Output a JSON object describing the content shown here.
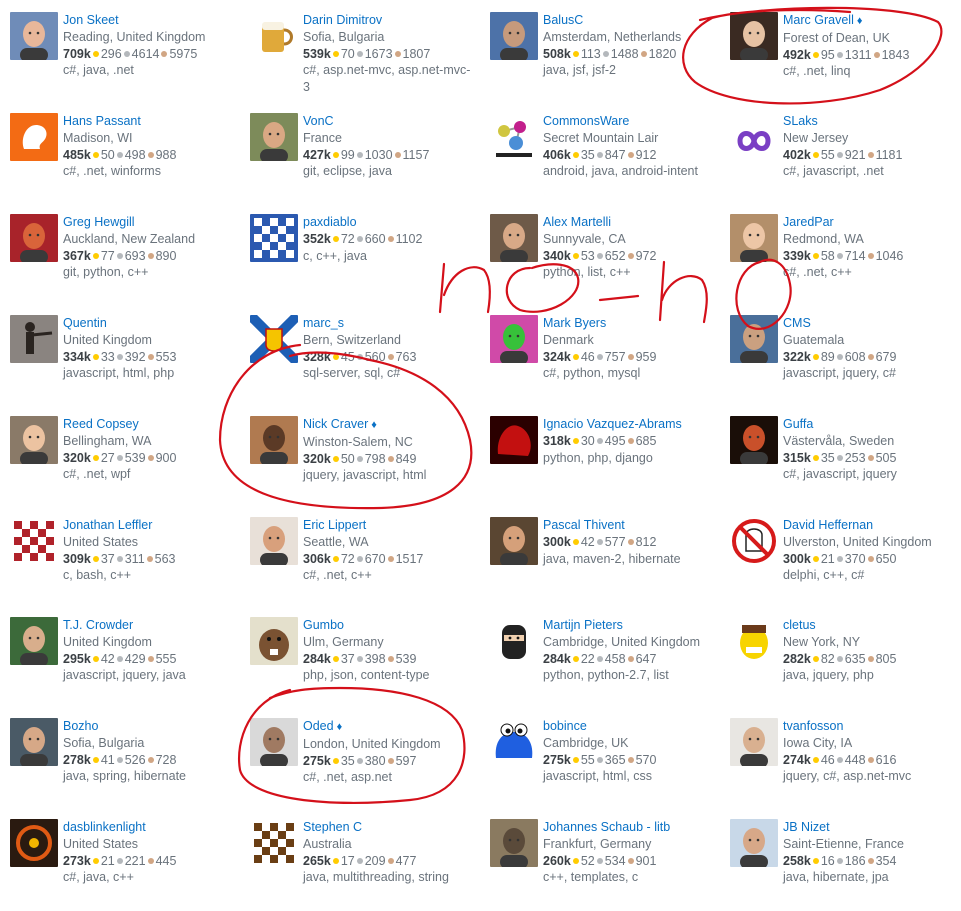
{
  "colors": {
    "link": "#0a71c5",
    "text": "#6a737c",
    "ink": "#d4101a",
    "gold": "#ffcc01",
    "silver": "#b4b8bc",
    "bronze": "#d1a684"
  },
  "users": [
    {
      "name": "Jon Skeet",
      "location": "Reading, United Kingdom",
      "rep": "709k",
      "gold": "296",
      "silver": "4614",
      "bronze": "5975",
      "tags": "c#, java, .net",
      "avatar": {
        "bg": "#6f8cb8",
        "fg": "#e8b79a",
        "type": "face"
      }
    },
    {
      "name": "Darin Dimitrov",
      "location": "Sofia, Bulgaria",
      "rep": "539k",
      "gold": "70",
      "silver": "1673",
      "bronze": "1807",
      "tags": "c#, asp.net-mvc, asp.net-mvc-3",
      "avatar": {
        "bg": "#ffffff",
        "fg": "#e0a93a",
        "type": "mug"
      }
    },
    {
      "name": "BalusC",
      "location": "Amsterdam, Netherlands",
      "rep": "508k",
      "gold": "113",
      "silver": "1488",
      "bronze": "1820",
      "tags": "java, jsf, jsf-2",
      "avatar": {
        "bg": "#4d72a8",
        "fg": "#c69a7c",
        "type": "face"
      }
    },
    {
      "name": "Marc Gravell",
      "moderator": true,
      "location": "Forest of Dean, UK",
      "rep": "492k",
      "gold": "95",
      "silver": "1311",
      "bronze": "1843",
      "tags": "c#, .net, linq",
      "avatar": {
        "bg": "#3a2a22",
        "fg": "#e6c2a4",
        "type": "face"
      }
    },
    {
      "name": "Hans Passant",
      "location": "Madison, WI",
      "rep": "485k",
      "gold": "50",
      "silver": "498",
      "bronze": "988",
      "tags": "c#, .net, winforms",
      "avatar": {
        "bg": "#f36b14",
        "fg": "#ffffff",
        "type": "lion"
      }
    },
    {
      "name": "VonC",
      "location": "France",
      "rep": "427k",
      "gold": "99",
      "silver": "1030",
      "bronze": "1157",
      "tags": "git, eclipse, java",
      "avatar": {
        "bg": "#7d8b5a",
        "fg": "#d9a884",
        "type": "face"
      }
    },
    {
      "name": "CommonsWare",
      "location": "Secret Mountain Lair",
      "rep": "406k",
      "gold": "35",
      "silver": "847",
      "bronze": "912",
      "tags": "android, java, android-intent",
      "avatar": {
        "bg": "#ffffff",
        "fg": "#c21f8c",
        "type": "molecule"
      }
    },
    {
      "name": "SLaks",
      "location": "New Jersey",
      "rep": "402k",
      "gold": "55",
      "silver": "921",
      "bronze": "1181",
      "tags": "c#, javascript, .net",
      "avatar": {
        "bg": "#ffffff",
        "fg": "#7a3fc4",
        "type": "infinity"
      }
    },
    {
      "name": "Greg Hewgill",
      "location": "Auckland, New Zealand",
      "rep": "367k",
      "gold": "77",
      "silver": "693",
      "bronze": "890",
      "tags": "git, python, c++",
      "avatar": {
        "bg": "#a8232a",
        "fg": "#d9643a",
        "type": "face"
      }
    },
    {
      "name": "paxdiablo",
      "location": "",
      "rep": "352k",
      "gold": "72",
      "silver": "660",
      "bronze": "1102",
      "tags": "c, c++, java",
      "avatar": {
        "bg": "#2b59b0",
        "fg": "#ffffff",
        "type": "pattern"
      }
    },
    {
      "name": "Alex Martelli",
      "location": "Sunnyvale, CA",
      "rep": "340k",
      "gold": "53",
      "silver": "652",
      "bronze": "972",
      "tags": "python, list, c++",
      "avatar": {
        "bg": "#6e5a48",
        "fg": "#d8a987",
        "type": "face"
      }
    },
    {
      "name": "JaredPar",
      "location": "Redmond, WA",
      "rep": "339k",
      "gold": "58",
      "silver": "714",
      "bronze": "1046",
      "tags": "c#, .net, c++",
      "avatar": {
        "bg": "#b38f6a",
        "fg": "#edc6a6",
        "type": "face"
      }
    },
    {
      "name": "Quentin",
      "location": "United Kingdom",
      "rep": "334k",
      "gold": "33",
      "silver": "392",
      "bronze": "553",
      "tags": "javascript, html, php",
      "avatar": {
        "bg": "#8a8480",
        "fg": "#2a2420",
        "type": "silhouette"
      }
    },
    {
      "name": "marc_s",
      "location": "Bern, Switzerland",
      "rep": "328k",
      "gold": "45",
      "silver": "560",
      "bronze": "763",
      "tags": "sql-server, sql, c#",
      "avatar": {
        "bg": "#1d5fb5",
        "fg": "#f5c400",
        "type": "flag"
      }
    },
    {
      "name": "Mark Byers",
      "location": "Denmark",
      "rep": "324k",
      "gold": "46",
      "silver": "757",
      "bronze": "959",
      "tags": "c#, python, mysql",
      "avatar": {
        "bg": "#d04aa8",
        "fg": "#37c13a",
        "type": "face"
      }
    },
    {
      "name": "CMS",
      "location": "Guatemala",
      "rep": "322k",
      "gold": "89",
      "silver": "608",
      "bronze": "679",
      "tags": "javascript, jquery, c#",
      "avatar": {
        "bg": "#4a6f9a",
        "fg": "#caa080",
        "type": "face"
      }
    },
    {
      "name": "Reed Copsey",
      "location": "Bellingham, WA",
      "rep": "320k",
      "gold": "27",
      "silver": "539",
      "bronze": "900",
      "tags": "c#, .net, wpf",
      "avatar": {
        "bg": "#8a7a68",
        "fg": "#ecc3a1",
        "type": "face"
      }
    },
    {
      "name": "Nick Craver",
      "moderator": true,
      "location": "Winston-Salem, NC",
      "rep": "320k",
      "gold": "50",
      "silver": "798",
      "bronze": "849",
      "tags": "jquery, javascript, html",
      "avatar": {
        "bg": "#b07a50",
        "fg": "#5b3a26",
        "type": "face"
      }
    },
    {
      "name": "Ignacio Vazquez-Abrams",
      "location": "",
      "rep": "318k",
      "gold": "30",
      "silver": "495",
      "bronze": "685",
      "tags": "python, php, django",
      "avatar": {
        "bg": "#2b0000",
        "fg": "#c31010",
        "type": "blob"
      }
    },
    {
      "name": "Guffa",
      "location": "Västervåla, Sweden",
      "rep": "315k",
      "gold": "35",
      "silver": "253",
      "bronze": "505",
      "tags": "c#, javascript, jquery",
      "avatar": {
        "bg": "#1a0e08",
        "fg": "#c9502a",
        "type": "face"
      }
    },
    {
      "name": "Jonathan Leffler",
      "location": "United States",
      "rep": "309k",
      "gold": "37",
      "silver": "311",
      "bronze": "563",
      "tags": "c, bash, c++",
      "avatar": {
        "bg": "#ffffff",
        "fg": "#b0222a",
        "type": "pattern"
      }
    },
    {
      "name": "Eric Lippert",
      "location": "Seattle, WA",
      "rep": "306k",
      "gold": "72",
      "silver": "670",
      "bronze": "1517",
      "tags": "c#, .net, c++",
      "avatar": {
        "bg": "#e8e0d8",
        "fg": "#d8a07c",
        "type": "face"
      }
    },
    {
      "name": "Pascal Thivent",
      "location": "",
      "rep": "300k",
      "gold": "42",
      "silver": "577",
      "bronze": "812",
      "tags": "java, maven-2, hibernate",
      "avatar": {
        "bg": "#5a4632",
        "fg": "#d5a07a",
        "type": "face"
      }
    },
    {
      "name": "David Heffernan",
      "location": "Ulverston, United Kingdom",
      "rep": "300k",
      "gold": "21",
      "silver": "370",
      "bronze": "650",
      "tags": "delphi, c++, c#",
      "avatar": {
        "bg": "#ffffff",
        "fg": "#d61a1a",
        "type": "ghost"
      }
    },
    {
      "name": "T.J. Crowder",
      "location": "United Kingdom",
      "rep": "295k",
      "gold": "42",
      "silver": "429",
      "bronze": "555",
      "tags": "javascript, jquery, java",
      "avatar": {
        "bg": "#3c6a3a",
        "fg": "#d8ae8c",
        "type": "face"
      }
    },
    {
      "name": "Gumbo",
      "location": "Ulm, Germany",
      "rep": "284k",
      "gold": "37",
      "silver": "398",
      "bronze": "539",
      "tags": "php, json, content-type",
      "avatar": {
        "bg": "#e4e0cc",
        "fg": "#7a5232",
        "type": "beaver"
      }
    },
    {
      "name": "Martijn Pieters",
      "location": "Cambridge, United Kingdom",
      "rep": "284k",
      "gold": "22",
      "silver": "458",
      "bronze": "647",
      "tags": "python, python-2.7, list",
      "avatar": {
        "bg": "#ffffff",
        "fg": "#222222",
        "type": "ninja"
      }
    },
    {
      "name": "cletus",
      "location": "New York, NY",
      "rep": "282k",
      "gold": "82",
      "silver": "635",
      "bronze": "805",
      "tags": "java, jquery, php",
      "avatar": {
        "bg": "#ffffff",
        "fg": "#f7d400",
        "type": "cartoon"
      }
    },
    {
      "name": "Bozho",
      "location": "Sofia, Bulgaria",
      "rep": "278k",
      "gold": "41",
      "silver": "526",
      "bronze": "728",
      "tags": "java, spring, hibernate",
      "avatar": {
        "bg": "#4a5a66",
        "fg": "#d6a887",
        "type": "face"
      }
    },
    {
      "name": "Oded",
      "moderator": true,
      "location": "London, United Kingdom",
      "rep": "275k",
      "gold": "35",
      "silver": "380",
      "bronze": "597",
      "tags": "c#, .net, asp.net",
      "avatar": {
        "bg": "#d9d9d9",
        "fg": "#a07a62",
        "type": "face"
      }
    },
    {
      "name": "bobince",
      "location": "Cambridge, UK",
      "rep": "275k",
      "gold": "55",
      "silver": "365",
      "bronze": "570",
      "tags": "javascript, html, css",
      "avatar": {
        "bg": "#ffffff",
        "fg": "#1f5fe0",
        "type": "monster"
      }
    },
    {
      "name": "tvanfosson",
      "location": "Iowa City, IA",
      "rep": "274k",
      "gold": "46",
      "silver": "448",
      "bronze": "616",
      "tags": "jquery, c#, asp.net-mvc",
      "avatar": {
        "bg": "#e8e6e2",
        "fg": "#d9b090",
        "type": "face"
      }
    },
    {
      "name": "dasblinkenlight",
      "location": "United States",
      "rep": "273k",
      "gold": "21",
      "silver": "221",
      "bronze": "445",
      "tags": "c#, java, c++",
      "avatar": {
        "bg": "#2a1a10",
        "fg": "#e05a14",
        "type": "ring"
      }
    },
    {
      "name": "Stephen C",
      "location": "Australia",
      "rep": "265k",
      "gold": "17",
      "silver": "209",
      "bronze": "477",
      "tags": "java, multithreading, string",
      "avatar": {
        "bg": "#ffffff",
        "fg": "#6a3e14",
        "type": "pattern"
      }
    },
    {
      "name": "Johannes Schaub - litb",
      "location": "Frankfurt, Germany",
      "rep": "260k",
      "gold": "52",
      "silver": "534",
      "bronze": "901",
      "tags": "c++, templates, c",
      "avatar": {
        "bg": "#8a7a60",
        "fg": "#5a4a3a",
        "type": "face"
      }
    },
    {
      "name": "JB Nizet",
      "location": "Saint-Etienne, France",
      "rep": "258k",
      "gold": "16",
      "silver": "186",
      "bronze": "354",
      "tags": "java, hibernate, jpa",
      "avatar": {
        "bg": "#c8d8e8",
        "fg": "#d7a888",
        "type": "face"
      }
    }
  ],
  "annotation": {
    "text": "no-no"
  },
  "icons": {
    "moderator": "diamond-icon"
  }
}
